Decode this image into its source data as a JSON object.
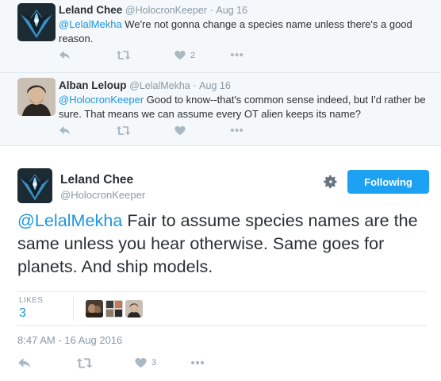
{
  "replies": [
    {
      "fullname": "Leland Chee",
      "handle": "@HolocronKeeper",
      "separator": "·",
      "date": "Aug 16",
      "mention": "@LelalMekha",
      "text": " We're not gonna change a species name unless there's a good reason.",
      "like_count": "2"
    },
    {
      "fullname": "Alban Leloup",
      "handle": "@LelalMekha",
      "separator": "·",
      "date": "Aug 16",
      "mention": "@HolocronKeeper",
      "text": " Good to know--that's common sense indeed, but I'd rather be sure. That means we can assume every OT alien keeps its name?",
      "like_count": ""
    }
  ],
  "main_tweet": {
    "fullname": "Leland Chee",
    "handle": "@HolocronKeeper",
    "follow_label": "Following",
    "mention": "@LelalMekha",
    "text": " Fair to assume species names are the same unless you hear otherwise. Same goes for planets. And ship models.",
    "likes_label": "LIKES",
    "likes_count": "3",
    "timestamp": "8:47 AM - 16 Aug 2016",
    "like_count": "3"
  },
  "icons": {
    "reply": "reply-icon",
    "retweet": "retweet-icon",
    "like": "heart-icon",
    "more": "more-icon",
    "settings": "gear-icon"
  },
  "colors": {
    "accent": "#1da1f2",
    "link": "#1b95e0",
    "muted": "#8899a6",
    "action_icon": "#aab8c2",
    "thread_bg": "#f5f8fa"
  }
}
